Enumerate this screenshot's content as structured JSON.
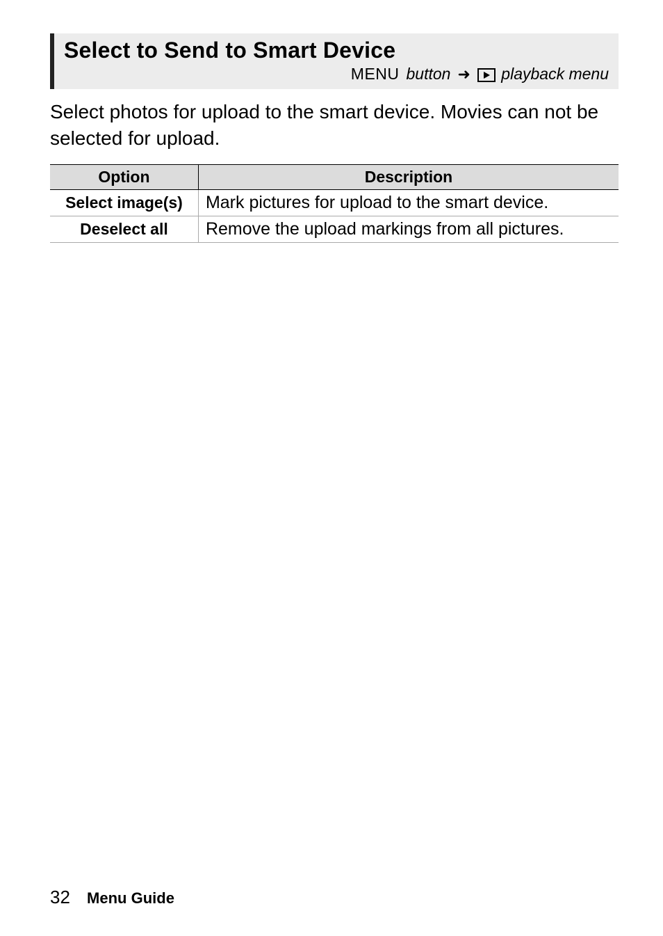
{
  "heading": {
    "title": "Select to Send to Smart Device",
    "menu_label": "MENU",
    "button_word": "button",
    "arrow": "➜",
    "playback_text": "playback menu"
  },
  "body": "Select photos for upload to the smart device.  Movies can not be selected for upload.",
  "table": {
    "headers": {
      "option": "Option",
      "description": "Description"
    },
    "rows": [
      {
        "option": "Select image(s)",
        "description": "Mark pictures for upload to the smart device."
      },
      {
        "option": "Deselect all",
        "description": "Remove the upload markings from all pictures."
      }
    ]
  },
  "footer": {
    "page": "32",
    "section": "Menu Guide"
  }
}
